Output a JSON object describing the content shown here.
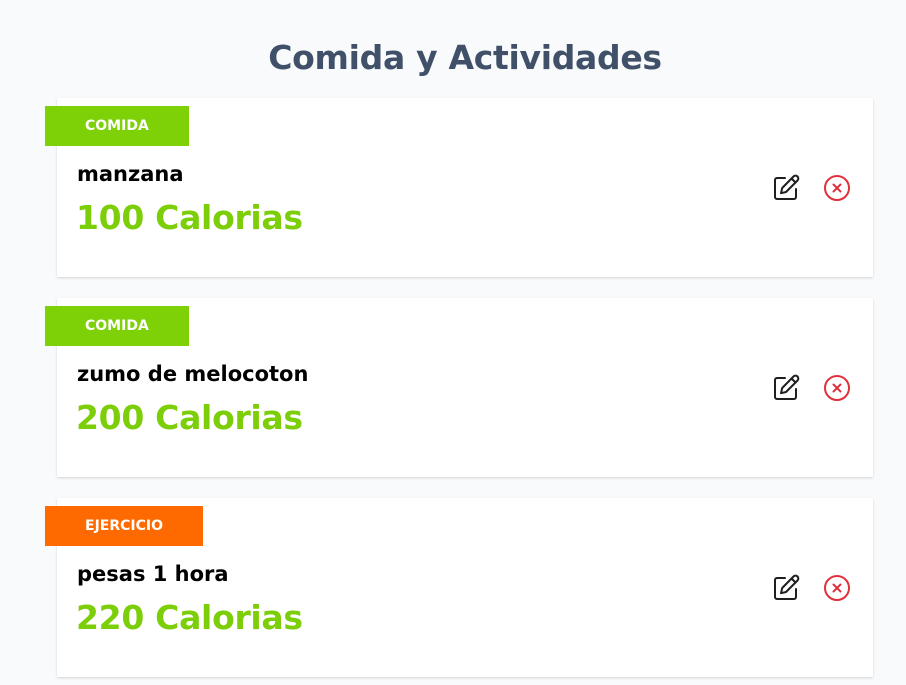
{
  "page": {
    "title": "Comida y Actividades"
  },
  "colors": {
    "food_badge": "#7ed106",
    "exercise_badge": "#ff6a00",
    "calories_text": "#7cce08",
    "title_text": "#3f5068",
    "delete_icon": "#e0303e",
    "edit_icon": "#1f1f1f"
  },
  "entries": [
    {
      "category": "COMIDA",
      "category_type": "food",
      "name": "manzana",
      "calories": "100 Calorias",
      "edit_icon": "pencil-square-icon",
      "delete_icon": "x-circle-icon"
    },
    {
      "category": "COMIDA",
      "category_type": "food",
      "name": "zumo de melocoton",
      "calories": "200 Calorias",
      "edit_icon": "pencil-square-icon",
      "delete_icon": "x-circle-icon"
    },
    {
      "category": "EJERCICIO",
      "category_type": "exercise",
      "name": "pesas 1 hora",
      "calories": "220 Calorias",
      "edit_icon": "pencil-square-icon",
      "delete_icon": "x-circle-icon"
    }
  ]
}
